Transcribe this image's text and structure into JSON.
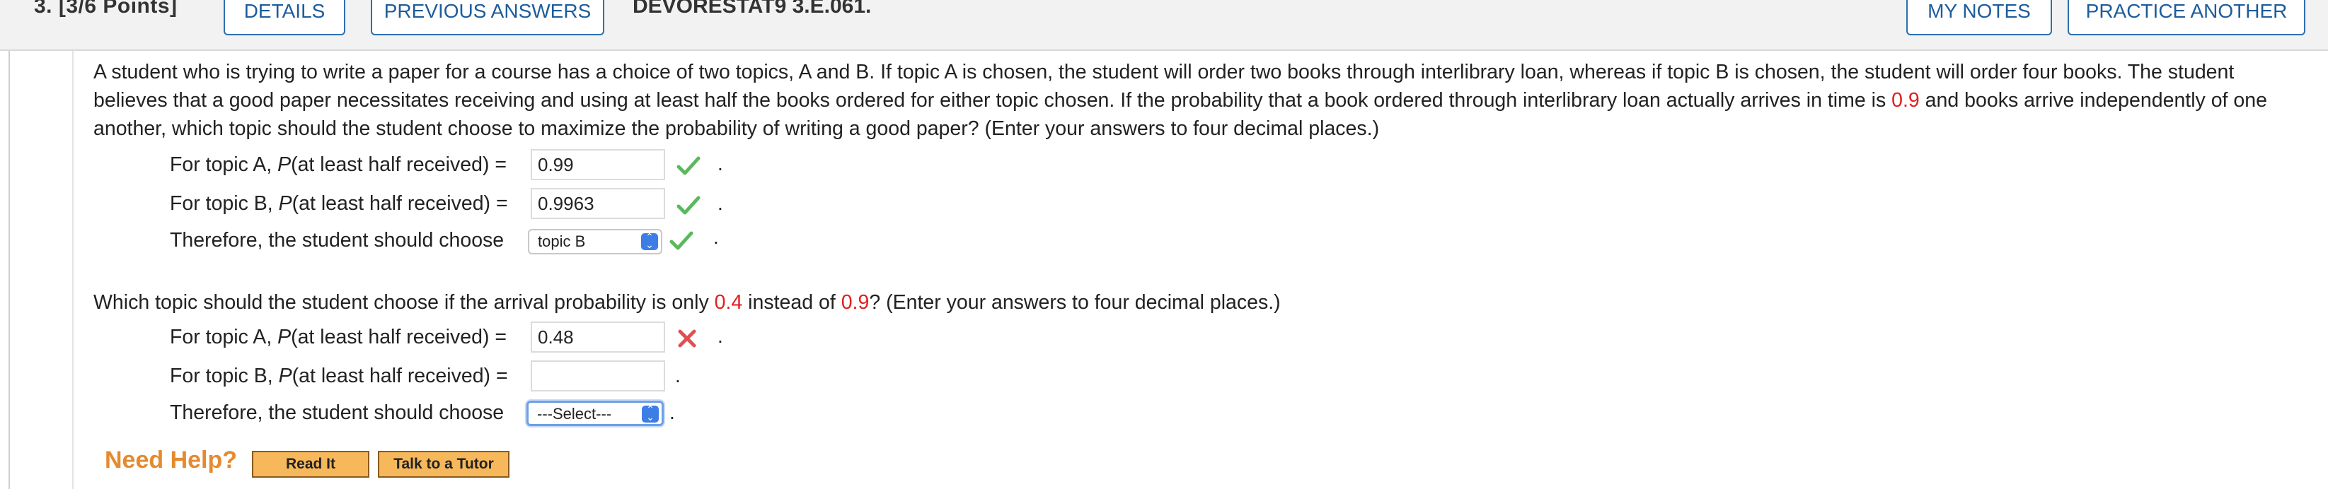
{
  "header": {
    "question_label": "3.  [3/6 Points]",
    "details_label": "DETAILS",
    "previous_answers_label": "PREVIOUS ANSWERS",
    "assignment_code": "DEVORESTAT9 3.E.061.",
    "my_notes_label": "MY NOTES",
    "practice_another_label": "PRACTICE ANOTHER"
  },
  "problem": {
    "text_part1": "A student who is trying to write a paper for a course has a choice of two topics, A and B. If topic A is chosen, the student will order two books through interlibrary loan, whereas if topic B is chosen, the student will order four books. The student believes that a good paper necessitates receiving and using at least half the books ordered for either topic chosen. If the probability that a book ordered through interlibrary loan actually arrives in time is ",
    "prob1": "0.9",
    "text_part2": " and books arrive independently of one another, which topic should the student choose to maximize the probability of writing a good paper? (Enter your answers to four decimal places.)"
  },
  "part1": {
    "topicA_prefix": "For topic A, ",
    "P_symbol": "P",
    "topicA_suffix": "(at least half received) =",
    "topicA_value": "0.99",
    "topicB_prefix": "For topic B, ",
    "topicB_suffix": "(at least half received) =",
    "topicB_value": "0.9963",
    "choose_label": "Therefore, the student should choose",
    "choose_value": "topic B",
    "period": "."
  },
  "part2": {
    "text_a": "Which topic should the student choose if the arrival probability is only ",
    "prob_new": "0.4",
    "text_b": " instead of ",
    "prob_old": "0.9",
    "text_c": "? (Enter your answers to four decimal places.)",
    "topicA_prefix": "For topic A, ",
    "topicA_suffix": "(at least half received) =",
    "topicA_value": "0.48",
    "topicB_prefix": "For topic B, ",
    "topicB_suffix": "(at least half received) =",
    "topicB_value": "",
    "choose_label": "Therefore, the student should choose",
    "choose_value": "---Select---"
  },
  "help": {
    "label": "Need Help?",
    "read_it": "Read It",
    "talk_tutor": "Talk to a Tutor"
  },
  "colors": {
    "accent_blue": "#2e6fb0",
    "correct_green": "#5cb85c",
    "incorrect_red": "#e05050",
    "highlight_red": "#e02020",
    "help_orange": "#e58a2e"
  },
  "icons": [
    "check-icon",
    "x-icon",
    "chevron-updown-icon"
  ]
}
